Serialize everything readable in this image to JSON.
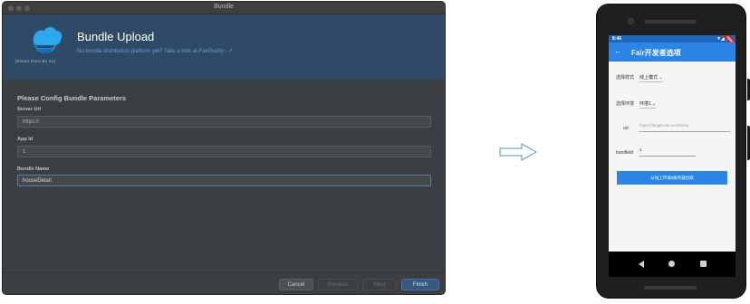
{
  "dialog": {
    "window_title": "Bundle",
    "logo_caption": "[Elaine Drew Bo Xu]",
    "header_title": "Bundle Upload",
    "header_link": "No bundle distribution platform yet? Take a look at FairPushy~ ↗",
    "section_title": "Please Config Bundle Parameters",
    "fields": [
      {
        "label": "Server Url",
        "value": "https://"
      },
      {
        "label": "App Id",
        "value": "1"
      },
      {
        "label": "Bundle Name",
        "value": "houseDetail"
      }
    ],
    "buttons": {
      "cancel": "Cancel",
      "previous": "Previous",
      "next": "Next",
      "finish": "Finish"
    },
    "colors": {
      "header_bg": "#2f4a66",
      "accent": "#365880",
      "link": "#6c9bd8"
    }
  },
  "phone": {
    "status_time": "8:46",
    "status_icons": "▼◢ ▮",
    "debug_banner": "DEBUG",
    "app_title": "Fair开发者选项",
    "rows": {
      "mode_label": "选择样式",
      "mode_value": "线上模式",
      "env_label": "选择环境",
      "env_value": "环境1",
      "url_label": "url",
      "url_value": "https://fangfe.58.com/fairsp",
      "bundle_label": "bundleId",
      "bundle_value": "1"
    },
    "action_button": "从线上环境5服务器拉取",
    "colors": {
      "app_bar": "#2b85e4",
      "status_bar": "#1f66bd"
    }
  }
}
